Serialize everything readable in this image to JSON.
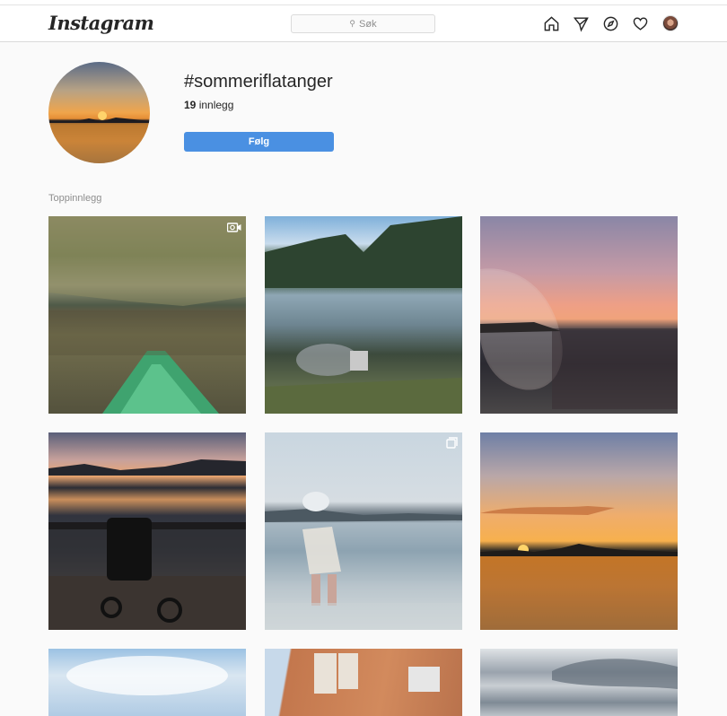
{
  "navbar": {
    "logo": "Instagram",
    "search_placeholder": "Søk",
    "icons": [
      "home-icon",
      "direct-message-icon",
      "explore-icon",
      "heart-icon",
      "profile-avatar"
    ]
  },
  "hashtag": {
    "title": "#sommeriflatanger",
    "posts_count": "19",
    "posts_label": "innlegg",
    "follow_label": "Følg"
  },
  "section": {
    "label": "Toppinnlegg"
  },
  "grid": {
    "tiles": [
      {
        "subject": "kayak on calm lake",
        "badge": "video-icon"
      },
      {
        "subject": "campfire by mountain lake",
        "badge": ""
      },
      {
        "subject": "wine glass at sunset",
        "badge": ""
      },
      {
        "subject": "stroller on dock at dusk",
        "badge": ""
      },
      {
        "subject": "child wading in sea",
        "badge": "carousel-icon"
      },
      {
        "subject": "sunset over fjord",
        "badge": ""
      },
      {
        "subject": "blue sky with clouds",
        "badge": ""
      },
      {
        "subject": "red wooden house",
        "badge": ""
      },
      {
        "subject": "cloudy sky",
        "badge": ""
      }
    ]
  },
  "colors": {
    "follow_button": "#4a90e2",
    "background": "#fafafa",
    "border": "#dbdbdb"
  }
}
